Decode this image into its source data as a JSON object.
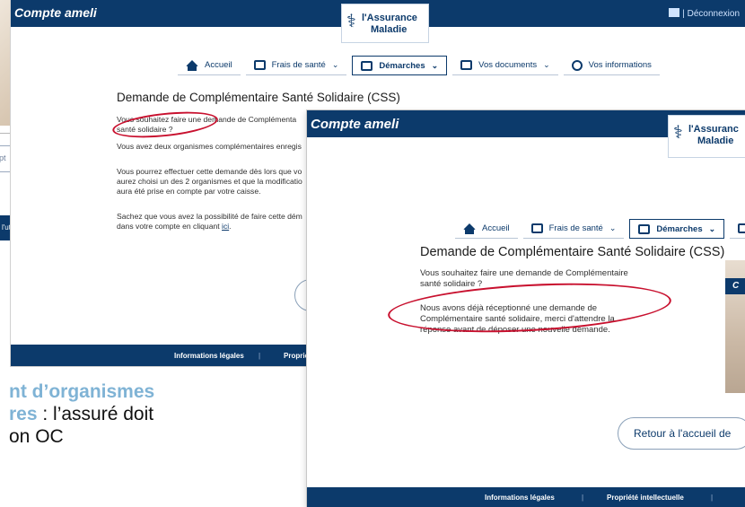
{
  "slide": {
    "line1": "nt d’organismes",
    "line2_highlight": "res",
    "line2_rest": " : l’assuré doit",
    "line3": "on OC"
  },
  "background": {
    "left_input_fragment": "pt",
    "left_button_fragment": "l'ut"
  },
  "window1": {
    "brand": "Compte ameli",
    "logout_label": "| Déconnexion",
    "logo": {
      "line1": "l'Assurance",
      "line2": "Maladie"
    },
    "nav": [
      {
        "label": "Accueil",
        "icon": "home-icon"
      },
      {
        "label": "Frais de santé",
        "icon": "card-icon",
        "chevron": "⌄"
      },
      {
        "label": "Démarches",
        "icon": "document-icon",
        "chevron": "⌄",
        "active": true
      },
      {
        "label": "Vos documents",
        "icon": "folder-icon",
        "chevron": "⌄"
      },
      {
        "label": "Vos informations",
        "icon": "user-icon"
      }
    ],
    "title": "Demande de Complémentaire Santé Solidaire (CSS)",
    "p1_l1": "Vous souhaitez faire une demande de Complémenta",
    "p1_l2": "santé solidaire ?",
    "p2": "Vous avez deux organismes complémentaires enregis",
    "p3_l1": "Vous pourrez effectuer cette demande dès lors que vo",
    "p3_l2": "aurez choisi un des 2 organismes et que la modificatio",
    "p3_l3": "aura été prise en compte par votre caisse.",
    "p4_l1": "Sachez que vous avez la possibilité de faire cette dém",
    "p4_l2": "dans votre compte en cliquant",
    "p4_link": "ici",
    "p4_end": ".",
    "footer_legal": "Informations légales",
    "footer_sep": "|",
    "footer_prop": "Proprié"
  },
  "window2": {
    "brand": "Compte ameli",
    "logo": {
      "line1": "l'Assuranc",
      "line2": "Maladie"
    },
    "nav": [
      {
        "label": "Accueil",
        "icon": "home-icon"
      },
      {
        "label": "Frais de santé",
        "icon": "card-icon",
        "chevron": "⌄"
      },
      {
        "label": "Démarches",
        "icon": "document-icon",
        "chevron": "⌄",
        "active": true
      }
    ],
    "title": "Demande de Complémentaire Santé Solidaire (CSS)",
    "p1_l1": "Vous souhaitez faire une demande de Complémentaire",
    "p1_l2": "santé solidaire ?",
    "p2_l1": "Nous avons déjà réceptionné une demande de",
    "p2_l2": "Complémentaire santé solidaire, merci d'attendre la",
    "p2_l3": "réponse avant de déposer une nouvelle demande.",
    "return_button": "Retour à l'accueil de",
    "side_tag": "C",
    "footer_legal": "Informations légales",
    "footer_sep": "|",
    "footer_prop": "Propriété intellectuelle",
    "footer_sep2": "|"
  },
  "colors": {
    "brand_navy": "#0c3a6b",
    "annotation_red": "#c8102e",
    "slide_highlight": "#7fb3d5"
  }
}
